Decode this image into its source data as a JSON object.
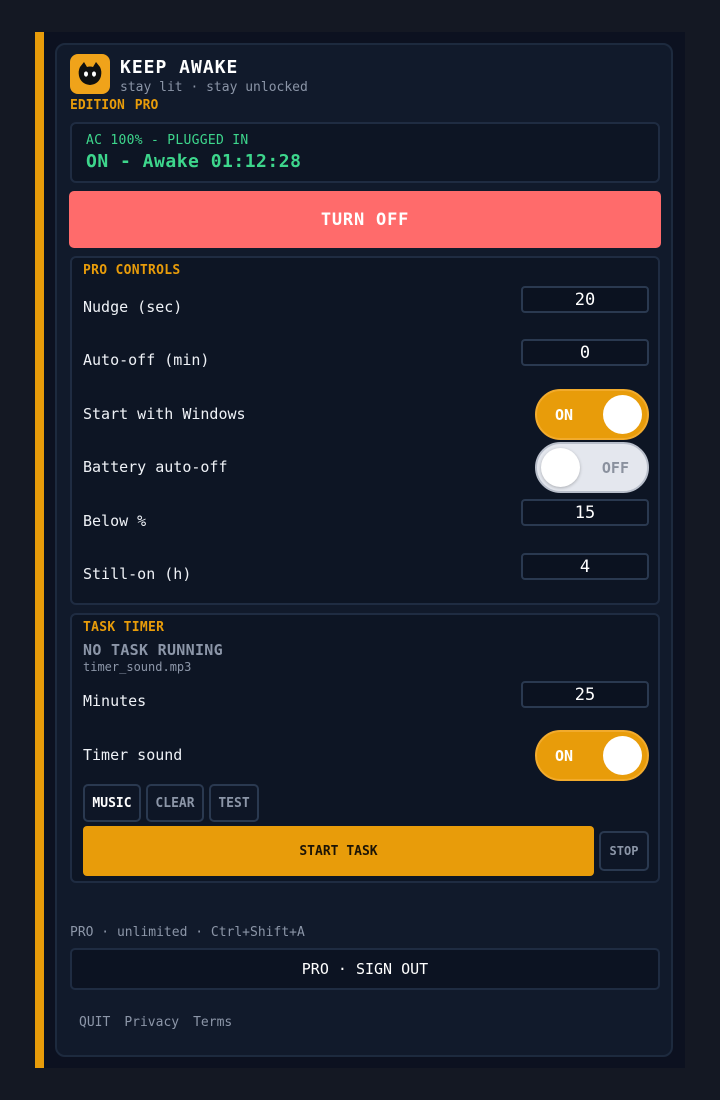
{
  "header": {
    "title": "KEEP AWAKE",
    "tagline": "stay lit · stay unlocked",
    "edition_label": "EDITION",
    "edition_value": "PRO"
  },
  "status": {
    "power": "AC 100% - PLUGGED IN",
    "state": "ON - Awake 01:12:28"
  },
  "main_button": "TURN OFF",
  "pro_controls": {
    "title": "PRO CONTROLS",
    "nudge_label": "Nudge (sec)",
    "nudge_value": "20",
    "auto_off_label": "Auto-off (min)",
    "auto_off_value": "0",
    "start_windows_label": "Start with Windows",
    "start_windows_state": "ON",
    "battery_label": "Battery auto-off",
    "battery_state": "OFF",
    "below_label": "Below %",
    "below_value": "15",
    "still_on_label": "Still-on (h)",
    "still_on_value": "4"
  },
  "task_timer": {
    "title": "TASK TIMER",
    "status": "NO TASK RUNNING",
    "sound_file": "timer_sound.mp3",
    "minutes_label": "Minutes",
    "minutes_value": "25",
    "sound_label": "Timer sound",
    "sound_state": "ON",
    "music_button": "MUSIC",
    "clear_button": "CLEAR",
    "test_button": "TEST",
    "start_button": "START TASK",
    "stop_button": "STOP"
  },
  "footer": {
    "info": "PRO · unlimited · Ctrl+Shift+A",
    "signout": "PRO · SIGN OUT",
    "quit": "QUIT",
    "privacy": "Privacy",
    "terms": "Terms"
  },
  "colors": {
    "accent": "#e89c0a",
    "status_green": "#3dd68c",
    "turn_off": "#ff6b6b",
    "background": "#141823"
  }
}
